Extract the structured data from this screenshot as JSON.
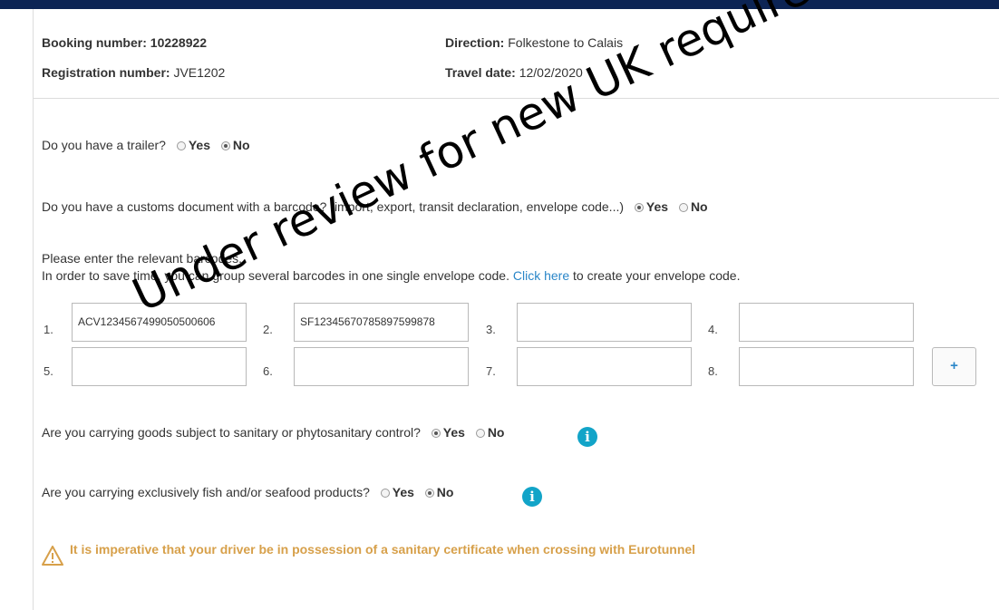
{
  "header": {
    "booking_label": "Booking number:",
    "booking_value": "10228922",
    "registration_label": "Registration number:",
    "registration_value": "JVE1202",
    "direction_label": "Direction:",
    "direction_value": "Folkestone to Calais",
    "travel_date_label": "Travel date:",
    "travel_date_value": "12/02/2020"
  },
  "trailer": {
    "question": "Do you have a trailer?",
    "yes": "Yes",
    "no": "No",
    "selected": "No"
  },
  "customs": {
    "question": "Do you have a customs document with a barcode? (import, export, transit declaration, envelope code...)",
    "yes": "Yes",
    "no": "No",
    "selected": "Yes"
  },
  "barcodes": {
    "intro_line1": "Please enter the relevant barcodes.",
    "intro_line2_before": "In order to save time, you can group several barcodes in one single envelope code.",
    "link_text": "Click here",
    "intro_line2_after": "to create your envelope code.",
    "fields": [
      {
        "num": "1.",
        "value": "ACV1234567499050500606"
      },
      {
        "num": "2.",
        "value": "SF12345670785897599878"
      },
      {
        "num": "3.",
        "value": ""
      },
      {
        "num": "4.",
        "value": ""
      },
      {
        "num": "5.",
        "value": ""
      },
      {
        "num": "6.",
        "value": ""
      },
      {
        "num": "7.",
        "value": ""
      },
      {
        "num": "8.",
        "value": ""
      }
    ],
    "add_label": "+"
  },
  "sanitary": {
    "question": "Are you carrying goods subject to sanitary or phytosanitary control?",
    "yes": "Yes",
    "no": "No",
    "selected": "Yes"
  },
  "fish": {
    "question": "Are you carrying exclusively fish and/or seafood products?",
    "yes": "Yes",
    "no": "No",
    "selected": "No"
  },
  "warning": {
    "text": "It is imperative that your driver be in possession of a sanitary certificate when crossing with Eurotunnel"
  },
  "watermark": "Under review for new UK requirements",
  "colors": {
    "top_bar": "#0c2454",
    "link": "#2a86c8",
    "info_icon": "#12a4c8",
    "warning": "#d7a04a"
  },
  "icons": {
    "info": "info-icon",
    "warning": "warning-triangle-icon",
    "add": "plus-icon"
  }
}
